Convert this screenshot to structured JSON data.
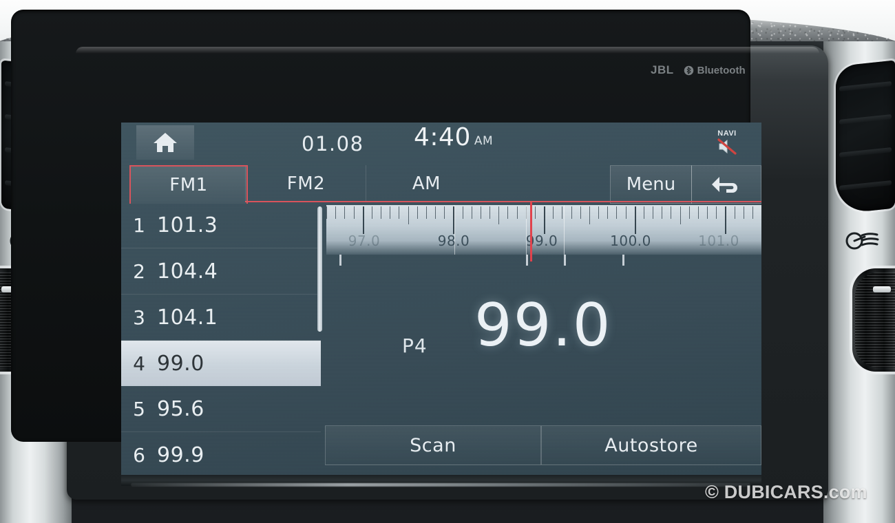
{
  "trim": {
    "airflow_icon_name": "airflow-vent-icon",
    "badges": {
      "jbl": "JBL",
      "bluetooth": "Bluetooth"
    }
  },
  "screen": {
    "status": {
      "home_icon": "home-icon",
      "date": "01.08",
      "time": "4:40",
      "ampm": "AM",
      "navi_label": "NAVI",
      "navi_icon": "speaker-mute-icon"
    },
    "tabs": [
      {
        "label": "FM1",
        "active": true
      },
      {
        "label": "FM2",
        "active": false
      },
      {
        "label": "AM",
        "active": false
      }
    ],
    "menu_label": "Menu",
    "back_icon": "back-arrow-icon",
    "presets": [
      {
        "number": "1",
        "freq": "101.3",
        "selected": false
      },
      {
        "number": "2",
        "freq": "104.4",
        "selected": false
      },
      {
        "number": "3",
        "freq": "104.1",
        "selected": false
      },
      {
        "number": "4",
        "freq": "99.0",
        "selected": true
      },
      {
        "number": "5",
        "freq": "95.6",
        "selected": false
      },
      {
        "number": "6",
        "freq": "99.9",
        "selected": false
      }
    ],
    "tuner": {
      "labels": [
        {
          "text": "97.0",
          "dim": true
        },
        {
          "text": "98.0",
          "dim": false
        },
        {
          "text": "99.0",
          "dim": false
        },
        {
          "text": "100.0",
          "dim": false
        },
        {
          "text": "101.0",
          "dim": true
        }
      ],
      "needle_value": "99.0",
      "range_min": "96.6",
      "range_max": "101.4"
    },
    "now_playing": {
      "preset_tag": "P4",
      "frequency": "99.0"
    },
    "actions": [
      {
        "label": "Scan"
      },
      {
        "label": "Autostore"
      }
    ],
    "colors": {
      "accent_red": "#d9545c",
      "needle_red": "#e0434d",
      "screen_bg": "#3a4f5a",
      "text": "#e8eef2"
    }
  },
  "watermark": "© DUBICARS.com"
}
